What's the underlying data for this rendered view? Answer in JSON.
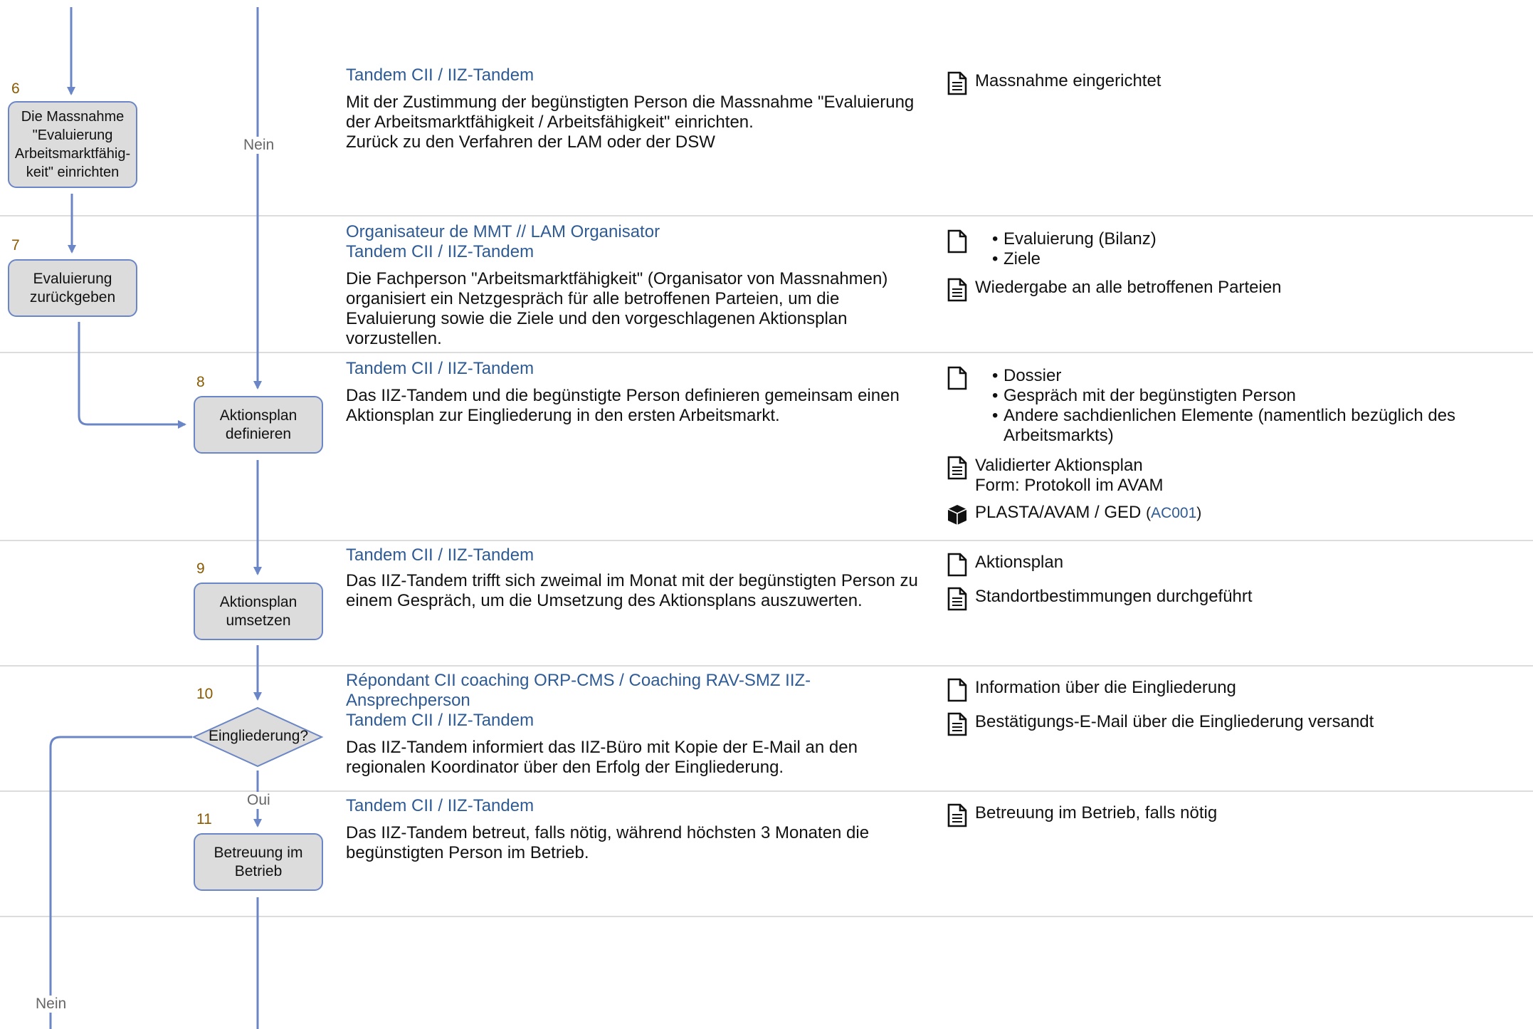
{
  "flow": {
    "nodes": [
      {
        "id": "n6",
        "step": "6",
        "label": "Die Massnahme \"Evaluierung Arbeitsmarktfähig-keit\" einrichten"
      },
      {
        "id": "n7",
        "step": "7",
        "label": "Evaluierung zurückgeben"
      },
      {
        "id": "n8",
        "step": "8",
        "label": "Aktionsplan definieren"
      },
      {
        "id": "n9",
        "step": "9",
        "label": "Aktionsplan umsetzen"
      },
      {
        "id": "n10",
        "step": "10",
        "label": "Eingliederung?"
      },
      {
        "id": "n11",
        "step": "11",
        "label": "Betreuung im Betrieb"
      }
    ],
    "edge_labels": {
      "nein_top": "Nein",
      "oui": "Oui",
      "nein_bottom": "Nein"
    }
  },
  "rows": [
    {
      "actors": [
        "Tandem CII / IIZ-Tandem"
      ],
      "text": "Mit der Zustimmung der begünstigten Person die Massnahme \"Evaluierung der Arbeitsmarktfähigkeit / Arbeitsfähigkeit\" einrichten.\nZurück zu den Verfahren der LAM oder der DSW",
      "outputs": [
        {
          "icon": "document-lines-icon",
          "text": "Massnahme eingerichtet"
        }
      ]
    },
    {
      "actors": [
        "Organisateur de MMT // LAM Organisator",
        "Tandem CII / IIZ-Tandem"
      ],
      "text": "Die Fachperson \"Arbeitsmarktfähigkeit\" (Organisator von Massnahmen) organisiert ein Netzgespräch für alle betroffenen Parteien, um die Evaluierung sowie die Ziele und den vorgeschlagenen Aktionsplan vorzustellen.",
      "outputs": [
        {
          "icon": "document-icon",
          "list": [
            "Evaluierung (Bilanz)",
            "Ziele"
          ]
        },
        {
          "icon": "document-lines-icon",
          "text": "Wiedergabe an alle betroffenen Parteien"
        }
      ]
    },
    {
      "actors": [
        "Tandem CII / IIZ-Tandem"
      ],
      "text": "Das IIZ-Tandem und die begünstigte Person definieren gemeinsam einen Aktionsplan zur Eingliederung in den ersten Arbeitsmarkt.",
      "outputs": [
        {
          "icon": "document-icon",
          "list": [
            "Dossier",
            "Gespräch mit der begünstigten Person",
            "Andere sachdienlichen Elemente (namentlich bezüglich des Arbeitsmarkts)"
          ]
        },
        {
          "icon": "document-lines-icon",
          "text": "Validierter Aktionsplan\nForm: Protokoll im AVAM"
        },
        {
          "icon": "cube-icon",
          "text": "PLASTA/AVAM / GED",
          "ref": "AC001"
        }
      ]
    },
    {
      "actors": [
        "Tandem CII / IIZ-Tandem"
      ],
      "text": "Das IIZ-Tandem trifft sich zweimal im Monat mit der begünstigten Person zu einem Gespräch, um die Umsetzung des Aktionsplans auszuwerten.",
      "outputs": [
        {
          "icon": "document-icon",
          "text": "Aktionsplan"
        },
        {
          "icon": "document-lines-icon",
          "text": "Standortbestimmungen durchgeführt"
        }
      ]
    },
    {
      "actors": [
        "Répondant CII coaching ORP-CMS / Coaching RAV-SMZ IIZ-Ansprechperson",
        "Tandem CII / IIZ-Tandem"
      ],
      "text": "Das IIZ-Tandem informiert das IIZ-Büro mit Kopie der E-Mail an den regionalen Koordinator über den Erfolg der Eingliederung.",
      "outputs": [
        {
          "icon": "document-icon",
          "text": "Information über die Eingliederung"
        },
        {
          "icon": "document-lines-icon",
          "text": "Bestätigungs-E-Mail über die Eingliederung versandt"
        }
      ]
    },
    {
      "actors": [
        "Tandem CII / IIZ-Tandem"
      ],
      "text": "Das IIZ-Tandem betreut, falls nötig, während höchsten 3 Monaten die begünstigten Person im Betrieb.",
      "outputs": [
        {
          "icon": "document-lines-icon",
          "text": "Betreuung im Betrieb, falls nötig"
        }
      ]
    }
  ],
  "colors": {
    "arrow": "#6b86c6",
    "node_fill": "#dcdcdc",
    "actor": "#2e5b95",
    "step": "#8a5a00",
    "separator": "#dcdcdc"
  }
}
